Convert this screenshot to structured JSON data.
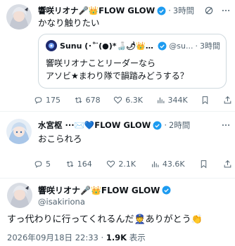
{
  "post1": {
    "name": "響咲リオナ🎤👑FLOW GLOW",
    "time": "3時間",
    "text": "かなり触りたい",
    "quote": {
      "name": "Sunu (･˚ ̈(●)*🍶🌶👑👾🐁",
      "handle": "@su...",
      "time": "3時間",
      "line1": "響咲リオナことリーダーなら",
      "line2": "アソビ★まわり隊で韻踏みどうする？"
    },
    "actions": {
      "replies": "175",
      "reposts": "678",
      "likes": "6.3K",
      "views": "344K"
    }
  },
  "post2": {
    "name": "水宮枢 ···✉️💙FLOW GLOW",
    "time": "2時間",
    "text": "おこられろ",
    "actions": {
      "replies": "5",
      "reposts": "164",
      "likes": "2.1K",
      "views": "43.6K"
    }
  },
  "post3": {
    "name": "響咲リオナ🎤👑FLOW GLOW",
    "handle": "@isakiriona",
    "text": "すっ代わりに行ってくれるんだ👮ありがとう👏",
    "timestamp": "2026年09月18日 22:33",
    "views": "1.9K",
    "views_label": "表示"
  },
  "colors": {
    "verified": "#1d9bf0",
    "muted": "#536471",
    "divider": "#eff3f4"
  }
}
